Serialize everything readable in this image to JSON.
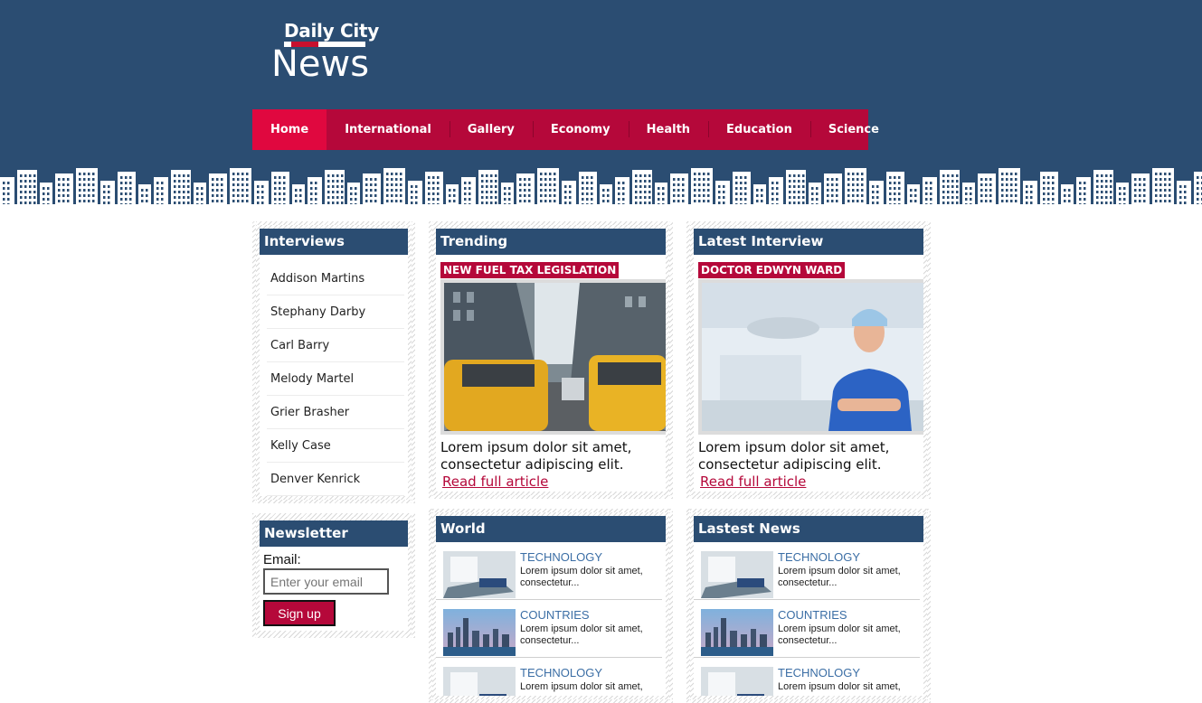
{
  "logo": {
    "top": "Daily City",
    "main": "News"
  },
  "nav": {
    "items": [
      "Home",
      "International",
      "Gallery",
      "Economy",
      "Health",
      "Education",
      "Science"
    ]
  },
  "interviews": {
    "title": "Interviews",
    "names": [
      "Addison Martins",
      "Stephany Darby",
      "Carl Barry",
      "Melody Martel",
      "Grier Brasher",
      "Kelly Case",
      "Denver Kenrick"
    ]
  },
  "newsletter": {
    "title": "Newsletter",
    "label": "Email:",
    "placeholder": "Enter your email",
    "button": "Sign up"
  },
  "trending": {
    "title": "Trending",
    "tag": "NEW FUEL TAX LEGISLATION",
    "text": "Lorem ipsum dolor sit amet, consectetur adipiscing elit.",
    "link": "Read full article"
  },
  "latest_interview": {
    "title": "Latest Interview",
    "tag": "DOCTOR EDWYN WARD",
    "text": "Lorem ipsum dolor sit amet, consectetur adipiscing elit.",
    "link": "Read full article"
  },
  "world": {
    "title": "World",
    "items": [
      {
        "category": "TECHNOLOGY",
        "desc": "Lorem ipsum dolor sit amet, consectetur..."
      },
      {
        "category": "COUNTRIES",
        "desc": "Lorem ipsum dolor sit amet, consectetur..."
      },
      {
        "category": "TECHNOLOGY",
        "desc": "Lorem ipsum dolor sit amet,"
      }
    ]
  },
  "latest_news": {
    "title": "Lastest News",
    "items": [
      {
        "category": "TECHNOLOGY",
        "desc": "Lorem ipsum dolor sit amet, consectetur..."
      },
      {
        "category": "COUNTRIES",
        "desc": "Lorem ipsum dolor sit amet, consectetur..."
      },
      {
        "category": "TECHNOLOGY",
        "desc": "Lorem ipsum dolor sit amet,"
      }
    ]
  },
  "colors": {
    "navy": "#2b4d72",
    "crimson": "#b5083a",
    "active": "#e0083f",
    "link_blue": "#3b6ea5"
  }
}
